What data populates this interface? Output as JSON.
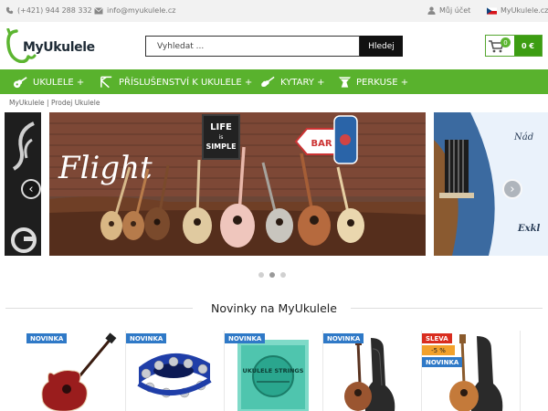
{
  "topbar": {
    "phone": "(+421) 944 288 332",
    "email": "info@myukulele.cz",
    "account": "Můj účet",
    "site": "MyUkulele.cz"
  },
  "header": {
    "logo_text": "MyUkulele",
    "search_placeholder": "Vyhledat ...",
    "search_button": "Hledej",
    "cart_count": "0",
    "cart_total": "0 €"
  },
  "nav": {
    "items": [
      {
        "label": "UKULELE +"
      },
      {
        "label": "PŘÍSLUŠENSTVÍ K UKULELE +"
      },
      {
        "label": "KYTARY +"
      },
      {
        "label": "PERKUSE +"
      }
    ]
  },
  "breadcrumb": "MyUkulele | Prodej Ukulele",
  "slider": {
    "main_title": "Flight",
    "sign_life": "LIFE",
    "sign_is": "is",
    "sign_simple": "SIMPLE",
    "sign_bar": "BAR",
    "right_text_top": "Nád",
    "right_text_bottom": "Exkl"
  },
  "section_title": "Novinky na MyUkulele",
  "products": [
    {
      "labels": [
        "NOVINKA"
      ],
      "name": "red acoustic guitar"
    },
    {
      "labels": [
        "NOVINKA"
      ],
      "name": "blue tambourine"
    },
    {
      "labels": [
        "NOVINKA"
      ],
      "name": "ukulele strings",
      "strings_brand": "UKULELE STRINGS"
    },
    {
      "labels": [
        "NOVINKA"
      ],
      "name": "ukulele with bag"
    },
    {
      "labels": [
        "SLEVA",
        "-5 %",
        "NOVINKA"
      ],
      "name": "ukulele with gig bag"
    }
  ],
  "colors": {
    "nav_green": "#59b22d",
    "cart_green": "#3c9d12",
    "badge_blue": "#2f79c7",
    "sale_red": "#d92d1f",
    "discount_orange": "#f2a12c"
  }
}
